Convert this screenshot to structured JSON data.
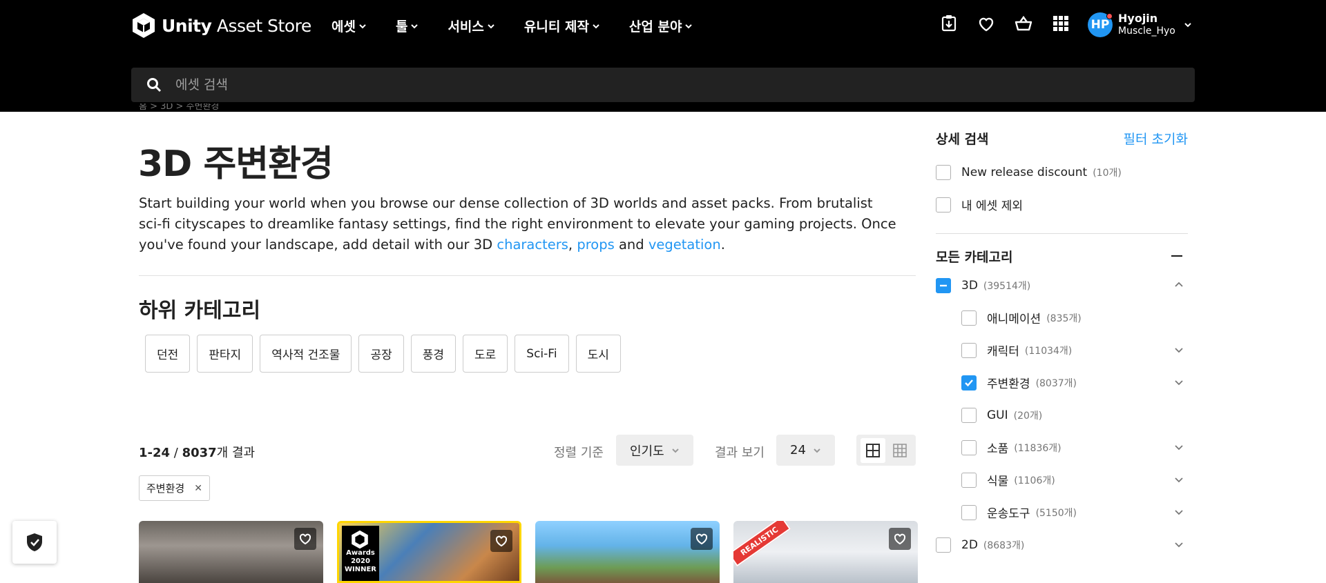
{
  "header": {
    "logo_bold": "Unity",
    "logo_rest": " Asset Store",
    "nav": [
      {
        "label": "에셋"
      },
      {
        "label": "툴"
      },
      {
        "label": "서비스"
      },
      {
        "label": "유니티 제작"
      },
      {
        "label": "산업 분야"
      }
    ],
    "user": {
      "initials": "HP",
      "name": "Hyojin",
      "username": "Muscle_Hyo"
    },
    "search_placeholder": "에셋 검색"
  },
  "breadcrumb": "홈 > 3D > 주변환경",
  "page": {
    "title": "3D 주변환경",
    "desc_1": "Start building your world when you browse our dense collection of 3D worlds and asset packs. From brutalist sci-fi cityscapes to dreamlike fantasy settings, find the right environment to elevate your gaming projects. Once you've found your landscape, add detail with our 3D ",
    "link_characters": "characters",
    "sep_comma": ", ",
    "link_props": "props",
    "sep_and": " and ",
    "link_vegetation": "vegetation",
    "end_period": ".",
    "subcat_title": "하위 카테고리",
    "subcats": [
      "던전",
      "판타지",
      "역사적 건조물",
      "공장",
      "풍경",
      "도로",
      "Sci-Fi",
      "도시"
    ]
  },
  "results": {
    "range": "1-24",
    "slash": " / ",
    "total": "8037",
    "suffix": "개 결과",
    "sort_label": "정렬 기준",
    "sort_value": "인기도",
    "view_label": "결과 보기",
    "view_value": "24",
    "active_tag": "주변환경"
  },
  "cards": {
    "award_text": "Awards 2020 WINNER",
    "realistic_text": "REALISTIC"
  },
  "sidebar": {
    "title": "상세 검색",
    "reset": "필터 초기화",
    "filters": [
      {
        "label": "New release discount",
        "count": "(10개)"
      },
      {
        "label": "내 에셋 제외",
        "count": ""
      }
    ],
    "categories_title": "모든 카테고리",
    "categories": [
      {
        "label": "3D",
        "count": "(39514개)",
        "state": "partial",
        "level": 0,
        "chev": "up"
      },
      {
        "label": "애니메이션",
        "count": "(835개)",
        "state": "off",
        "level": 1,
        "chev": ""
      },
      {
        "label": "캐릭터",
        "count": "(11034개)",
        "state": "off",
        "level": 1,
        "chev": "down"
      },
      {
        "label": "주변환경",
        "count": "(8037개)",
        "state": "on",
        "level": 1,
        "chev": "down"
      },
      {
        "label": "GUI",
        "count": "(20개)",
        "state": "off",
        "level": 1,
        "chev": ""
      },
      {
        "label": "소품",
        "count": "(11836개)",
        "state": "off",
        "level": 1,
        "chev": "down"
      },
      {
        "label": "식물",
        "count": "(1106개)",
        "state": "off",
        "level": 1,
        "chev": "down"
      },
      {
        "label": "운송도구",
        "count": "(5150개)",
        "state": "off",
        "level": 1,
        "chev": "down"
      },
      {
        "label": "2D",
        "count": "(8683개)",
        "state": "off",
        "level": 0,
        "chev": "down"
      }
    ]
  }
}
